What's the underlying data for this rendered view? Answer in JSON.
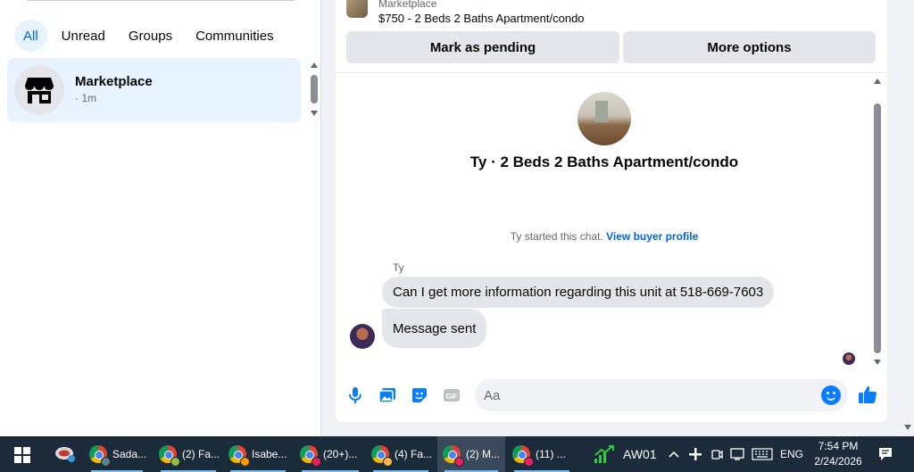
{
  "left_panel": {
    "filters": [
      "All",
      "Unread",
      "Groups",
      "Communities"
    ],
    "active_filter": "All",
    "thread": {
      "name": "Marketplace",
      "time": "· 1m",
      "icon": "store-icon"
    }
  },
  "chat": {
    "listing": {
      "source": "Marketplace",
      "title": "$750 - 2 Beds 2 Baths Apartment/condo"
    },
    "buttons": {
      "mark_pending": "Mark as pending",
      "more_options": "More options"
    },
    "header_title": "Ty · 2 Beds 2 Baths Apartment/condo",
    "system_text": "Ty started this chat.",
    "system_link": "View buyer profile",
    "sender": "Ty",
    "messages": [
      "Can I get more information regarding this unit at 518-669-7603",
      "Message sent"
    ],
    "composer": {
      "placeholder": "Aa",
      "tools": [
        "microphone-icon",
        "image-icon",
        "sticker-icon",
        "gif-icon"
      ]
    },
    "accent_color": "#0a7cff"
  },
  "taskbar": {
    "items": [
      "Sada...",
      "(2) Fa...",
      "Isabe...",
      "(20+)...",
      "(4) Fa...",
      "(2) M...",
      "(11) ..."
    ],
    "active_index": 5,
    "app": "AW01",
    "language": "ENG",
    "time": "7:54 PM",
    "date": "2/24/2026"
  }
}
